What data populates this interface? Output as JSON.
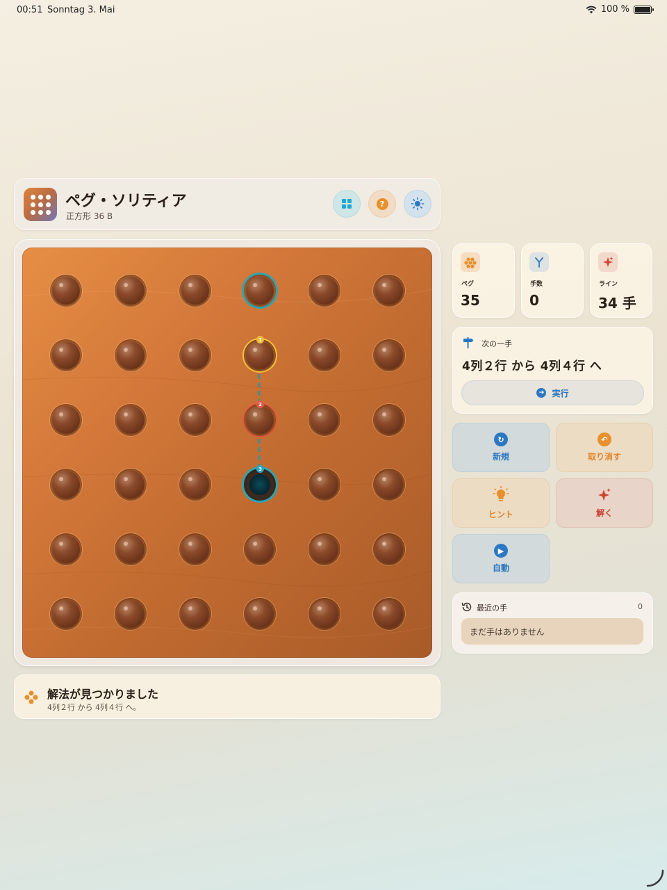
{
  "status_bar": {
    "time": "00:51",
    "date": "Sonntag 3. Mai",
    "battery": "100 %"
  },
  "header": {
    "title": "ペグ・ソリティア",
    "subtitle": "正方形 36 B",
    "buttons": [
      {
        "icon": "grid-icon"
      },
      {
        "icon": "help-icon"
      },
      {
        "icon": "theme-icon"
      }
    ]
  },
  "board": {
    "rows": 6,
    "cols": 6,
    "occupied": [
      [
        1,
        1,
        1,
        1,
        1,
        1
      ],
      [
        1,
        1,
        1,
        1,
        1,
        1
      ],
      [
        1,
        1,
        1,
        1,
        1,
        1
      ],
      [
        1,
        1,
        1,
        0,
        1,
        1
      ],
      [
        1,
        1,
        1,
        1,
        1,
        1
      ],
      [
        1,
        1,
        1,
        1,
        1,
        1
      ]
    ],
    "highlights": [
      {
        "row": 0,
        "col": 3,
        "style": "cyan"
      },
      {
        "row": 1,
        "col": 3,
        "style": "yellow",
        "badge": "1"
      },
      {
        "row": 2,
        "col": 3,
        "style": "red",
        "badge": "2"
      },
      {
        "row": 3,
        "col": 3,
        "style": "target",
        "badge": "3"
      }
    ],
    "colors": {
      "wood": "#d4793a",
      "cyan": "#2aa6b5",
      "yellow": "#f4c23b",
      "red": "#e45a44"
    }
  },
  "banner": {
    "title": "解法が見つかりました",
    "subtitle": "4列２行 から 4列４行 へ。"
  },
  "stats": {
    "pegs": {
      "label": "ペグ",
      "value": "35"
    },
    "moves": {
      "label": "手数",
      "value": "0"
    },
    "line": {
      "label": "ライン",
      "value": "34 手"
    }
  },
  "next_move": {
    "label": "次の一手",
    "move": "4列２行 から 4列４行 へ",
    "execute_label": "実行"
  },
  "actions": {
    "new": "新規",
    "undo": "取り消す",
    "hint": "ヒント",
    "solve": "解く",
    "auto": "自動"
  },
  "recent": {
    "label": "最近の手",
    "count": "0",
    "empty": "まだ手はありません"
  }
}
